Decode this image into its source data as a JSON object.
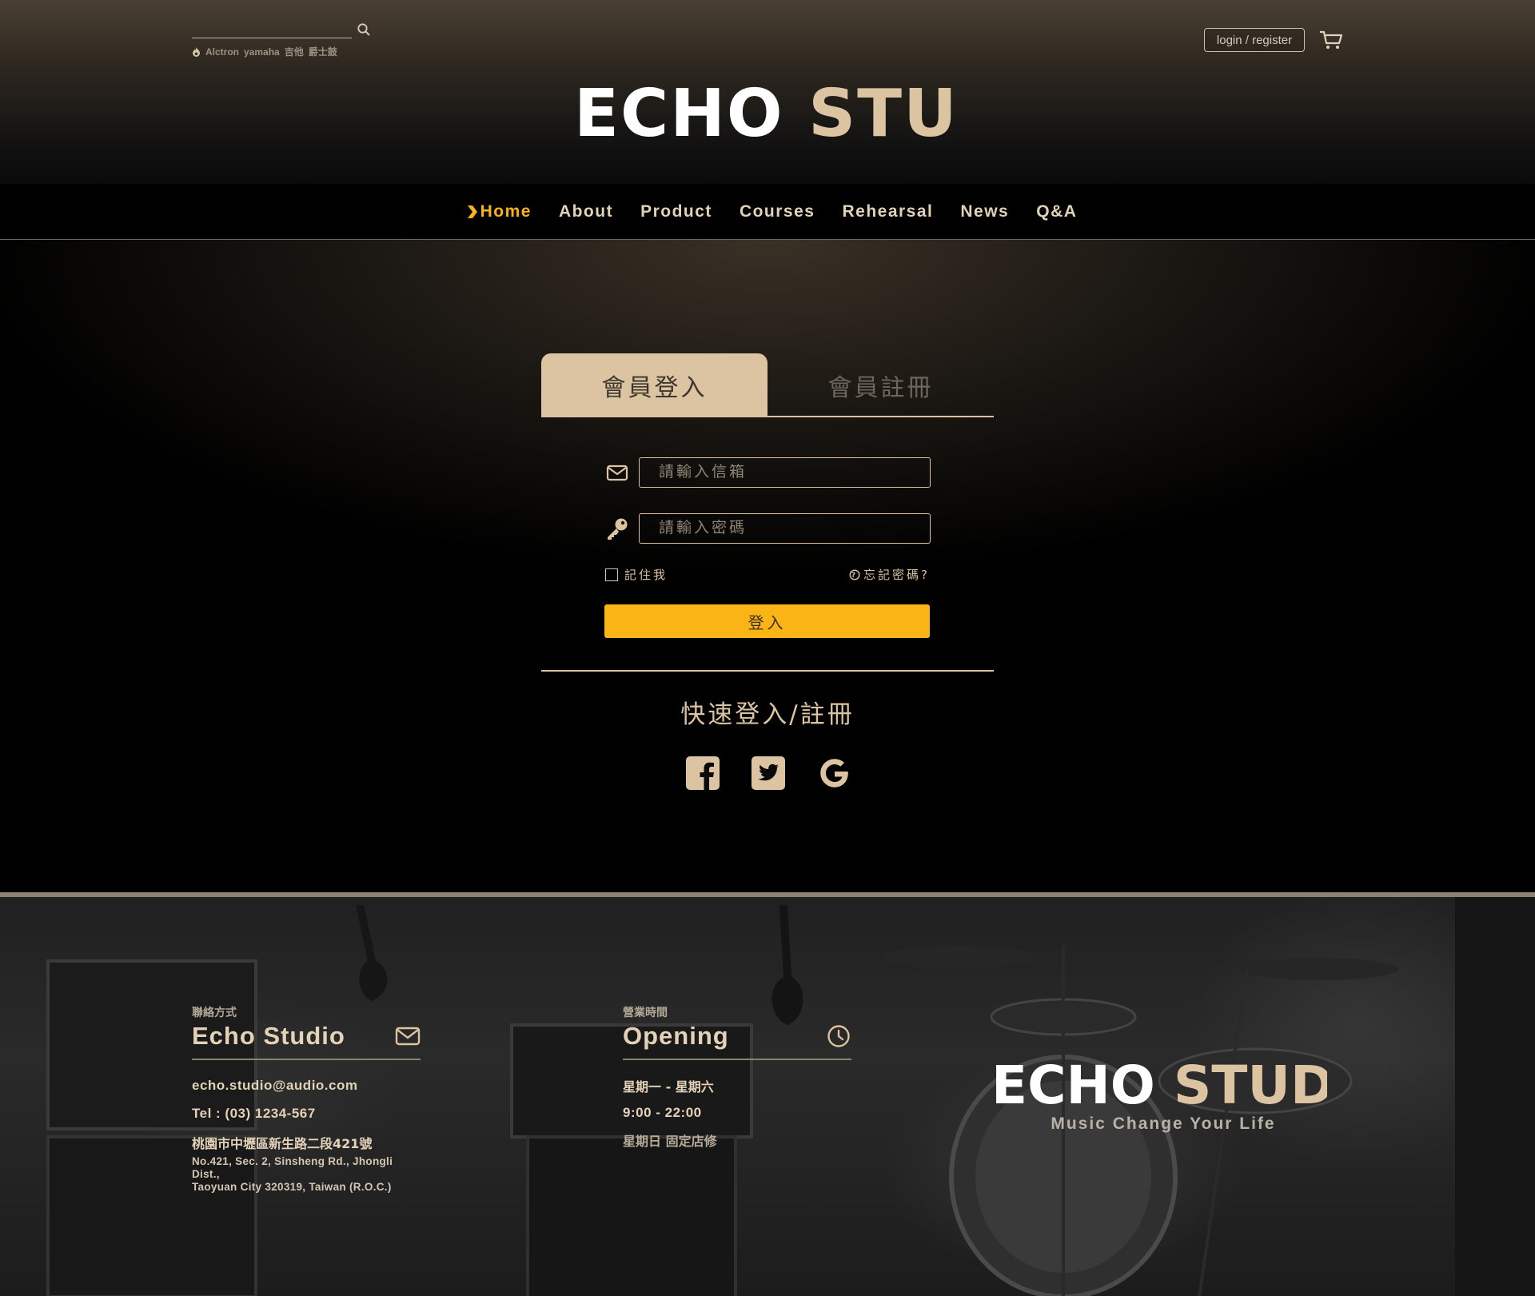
{
  "search": {
    "placeholder": "",
    "hot_tags": [
      "Alctron",
      "yamaha",
      "吉他",
      "爵士鼓"
    ]
  },
  "header": {
    "login_label": "login / register",
    "logo_text": "ECHO STUDIO"
  },
  "nav": {
    "items": [
      {
        "label": "Home",
        "active": true
      },
      {
        "label": "About"
      },
      {
        "label": "Product"
      },
      {
        "label": "Courses"
      },
      {
        "label": "Rehearsal"
      },
      {
        "label": "News"
      },
      {
        "label": "Q&A"
      }
    ]
  },
  "auth": {
    "tab_login": "會員登入",
    "tab_register": "會員註冊",
    "email_placeholder": "請輸入信箱",
    "password_placeholder": "請輸入密碼",
    "remember_label": "記住我",
    "forgot_label": "忘記密碼?",
    "submit_label": "登入",
    "quick_title": "快速登入/註冊",
    "social": [
      "facebook-icon",
      "twitter-icon",
      "google-icon"
    ]
  },
  "footer": {
    "contact": {
      "small_label": "聯絡方式",
      "title": "Echo Studio",
      "email": "echo.studio@audio.com",
      "tel": "Tel : (03) 1234-567",
      "address_zh": "桃園市中壢區新生路二段421號",
      "address_en_1": "No.421, Sec. 2, Sinsheng Rd., Jhongli Dist.,",
      "address_en_2": "Taoyuan City 320319, Taiwan (R.O.C.)"
    },
    "hours": {
      "small_label": "營業時間",
      "title": "Opening",
      "days": "星期一 - 星期六",
      "time": "9:00 - 22:00",
      "closed": "星期日 固定店修"
    },
    "logo_text": "ECHO STUDIO",
    "slogan": "Music Change Your Life"
  },
  "colors": {
    "accent": "#fbb416",
    "tan": "#dcc3a1",
    "dark": "#000000"
  }
}
